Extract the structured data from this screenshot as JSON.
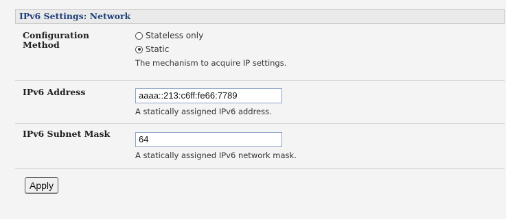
{
  "panel": {
    "title": "IPv6 Settings: Network"
  },
  "config_method": {
    "label": "Configuration Method",
    "options": [
      {
        "label": "Stateless only",
        "checked": false
      },
      {
        "label": "Static",
        "checked": true
      }
    ],
    "hint": "The mechanism to acquire IP settings."
  },
  "ipv6_address": {
    "label": "IPv6 Address",
    "value": "aaaa::213:c6ff:fe66:7789",
    "hint": "A statically assigned IPv6 address."
  },
  "subnet_mask": {
    "label": "IPv6 Subnet Mask",
    "value": "64",
    "hint": "A statically assigned IPv6 network mask."
  },
  "actions": {
    "apply_label": "Apply"
  }
}
